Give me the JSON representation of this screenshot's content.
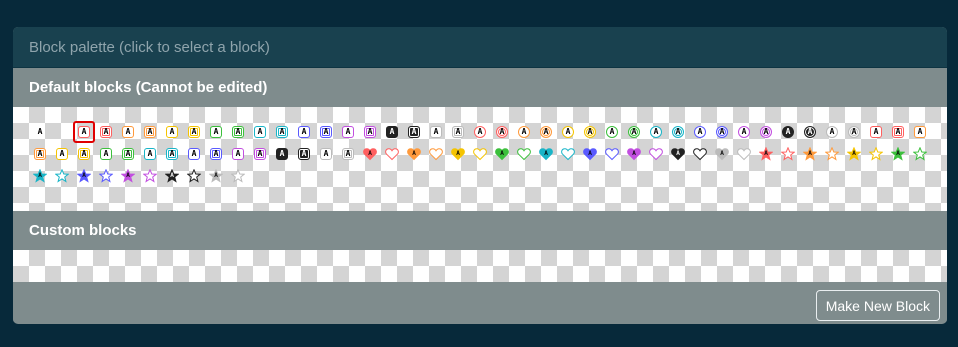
{
  "panel": {
    "header": "Block palette (click to select a block)",
    "default_title": "Default blocks (Cannot be edited)",
    "custom_title": "Custom blocks",
    "make_button": "Make New Block"
  },
  "glyph_letter": "A",
  "colors": {
    "red": "#ff6060",
    "orange": "#ff9a3c",
    "yellow": "#f5c400",
    "green": "#3cc03c",
    "teal": "#19b5c8",
    "blue": "#5a5aff",
    "purple": "#c24fe0",
    "black": "#222222",
    "white": "#bbbbbb"
  },
  "rows": [
    [
      {
        "shape": "plain",
        "color": "black",
        "icon": "plain-a-icon"
      },
      {
        "shape": "empty",
        "color": "none",
        "icon": "empty-block-icon"
      },
      {
        "shape": "square",
        "color": "red",
        "icon": "red-square-icon",
        "selected": true
      },
      {
        "shape": "square-inner",
        "color": "red",
        "icon": "red-square-inner-icon"
      },
      {
        "shape": "square",
        "color": "orange",
        "icon": "orange-square-icon"
      },
      {
        "shape": "square-inner",
        "color": "orange",
        "icon": "orange-square-inner-icon"
      },
      {
        "shape": "square",
        "color": "yellow",
        "icon": "yellow-square-icon"
      },
      {
        "shape": "square-inner",
        "color": "yellow",
        "icon": "yellow-square-inner-icon"
      },
      {
        "shape": "square",
        "color": "green",
        "icon": "green-square-icon"
      },
      {
        "shape": "square-inner",
        "color": "green",
        "icon": "green-square-inner-icon"
      },
      {
        "shape": "square",
        "color": "teal",
        "icon": "teal-square-icon"
      },
      {
        "shape": "square-inner",
        "color": "teal",
        "icon": "teal-square-inner-icon"
      },
      {
        "shape": "square",
        "color": "blue",
        "icon": "blue-square-icon"
      },
      {
        "shape": "square-inner",
        "color": "blue",
        "icon": "blue-square-inner-icon"
      },
      {
        "shape": "square",
        "color": "purple",
        "icon": "purple-square-icon"
      },
      {
        "shape": "square-inner",
        "color": "purple",
        "icon": "purple-square-inner-icon"
      },
      {
        "shape": "square",
        "color": "black",
        "icon": "black-square-icon",
        "fill": true
      },
      {
        "shape": "square-inner",
        "color": "black",
        "icon": "black-square-inner-icon",
        "fill": true
      },
      {
        "shape": "square",
        "color": "white",
        "icon": "white-square-icon"
      },
      {
        "shape": "square-inner",
        "color": "white",
        "icon": "white-square-inner-icon"
      },
      {
        "shape": "circle",
        "color": "red",
        "icon": "red-circle-icon"
      },
      {
        "shape": "circle-inner",
        "color": "red",
        "icon": "red-circle-inner-icon"
      },
      {
        "shape": "circle",
        "color": "orange",
        "icon": "orange-circle-icon"
      },
      {
        "shape": "circle-inner",
        "color": "orange",
        "icon": "orange-circle-inner-icon"
      },
      {
        "shape": "circle",
        "color": "yellow",
        "icon": "yellow-circle-icon"
      },
      {
        "shape": "circle-inner",
        "color": "yellow",
        "icon": "yellow-circle-inner-icon"
      },
      {
        "shape": "circle",
        "color": "green",
        "icon": "green-circle-icon"
      },
      {
        "shape": "circle-inner",
        "color": "green",
        "icon": "green-circle-inner-icon"
      },
      {
        "shape": "circle",
        "color": "teal",
        "icon": "teal-circle-icon"
      },
      {
        "shape": "circle-inner",
        "color": "teal",
        "icon": "teal-circle-inner-icon"
      },
      {
        "shape": "circle",
        "color": "blue",
        "icon": "blue-circle-icon"
      },
      {
        "shape": "circle-inner",
        "color": "blue",
        "icon": "blue-circle-inner-icon"
      },
      {
        "shape": "circle",
        "color": "purple",
        "icon": "purple-circle-icon"
      },
      {
        "shape": "circle-inner",
        "color": "purple",
        "icon": "purple-circle-inner-icon"
      },
      {
        "shape": "circle",
        "color": "black",
        "icon": "black-circle-icon",
        "fill": true
      },
      {
        "shape": "circle-inner",
        "color": "black",
        "icon": "black-circle-inner-icon",
        "fill": true
      },
      {
        "shape": "circle",
        "color": "white",
        "icon": "white-circle-icon"
      },
      {
        "shape": "circle-inner",
        "color": "white",
        "icon": "white-circle-inner-icon"
      },
      {
        "shape": "square",
        "color": "red",
        "icon": "red-square-alt-icon"
      },
      {
        "shape": "square-inner",
        "color": "red",
        "icon": "red-square-inner-alt-icon"
      },
      {
        "shape": "square",
        "color": "orange",
        "icon": "orange-square-alt-icon"
      }
    ],
    [
      {
        "shape": "square-inner",
        "color": "orange",
        "icon": "orange-square-inner-alt-icon"
      },
      {
        "shape": "square",
        "color": "yellow",
        "icon": "yellow-square-alt-icon"
      },
      {
        "shape": "square-inner",
        "color": "yellow",
        "icon": "yellow-square-inner-alt-icon"
      },
      {
        "shape": "square",
        "color": "green",
        "icon": "green-square-alt-icon"
      },
      {
        "shape": "square-inner",
        "color": "green",
        "icon": "green-square-inner-alt-icon"
      },
      {
        "shape": "square",
        "color": "teal",
        "icon": "teal-square-alt-icon"
      },
      {
        "shape": "square-inner",
        "color": "teal",
        "icon": "teal-square-inner-alt-icon"
      },
      {
        "shape": "square",
        "color": "blue",
        "icon": "blue-square-alt-icon"
      },
      {
        "shape": "square-inner",
        "color": "blue",
        "icon": "blue-square-inner-alt-icon"
      },
      {
        "shape": "square",
        "color": "purple",
        "icon": "purple-square-alt-icon"
      },
      {
        "shape": "square-inner",
        "color": "purple",
        "icon": "purple-square-inner-alt-icon"
      },
      {
        "shape": "square",
        "color": "black",
        "icon": "black-square-alt-icon",
        "fill": true
      },
      {
        "shape": "square-inner",
        "color": "black",
        "icon": "black-square-inner-alt-icon",
        "fill": true
      },
      {
        "shape": "square",
        "color": "white",
        "icon": "white-square-alt-icon"
      },
      {
        "shape": "square-inner",
        "color": "white",
        "icon": "white-square-inner-alt-icon"
      },
      {
        "shape": "heart",
        "color": "red",
        "icon": "red-heart-filled-icon",
        "fill": true
      },
      {
        "shape": "heart",
        "color": "red",
        "icon": "red-heart-icon"
      },
      {
        "shape": "heart",
        "color": "orange",
        "icon": "orange-heart-filled-icon",
        "fill": true
      },
      {
        "shape": "heart",
        "color": "orange",
        "icon": "orange-heart-icon"
      },
      {
        "shape": "heart",
        "color": "yellow",
        "icon": "yellow-heart-filled-icon",
        "fill": true
      },
      {
        "shape": "heart",
        "color": "yellow",
        "icon": "yellow-heart-icon"
      },
      {
        "shape": "heart",
        "color": "green",
        "icon": "green-heart-filled-icon",
        "fill": true
      },
      {
        "shape": "heart",
        "color": "green",
        "icon": "green-heart-icon"
      },
      {
        "shape": "heart",
        "color": "teal",
        "icon": "teal-heart-filled-icon",
        "fill": true
      },
      {
        "shape": "heart",
        "color": "teal",
        "icon": "teal-heart-icon"
      },
      {
        "shape": "heart",
        "color": "blue",
        "icon": "blue-heart-filled-icon",
        "fill": true
      },
      {
        "shape": "heart",
        "color": "blue",
        "icon": "blue-heart-icon"
      },
      {
        "shape": "heart",
        "color": "purple",
        "icon": "purple-heart-filled-icon",
        "fill": true
      },
      {
        "shape": "heart",
        "color": "purple",
        "icon": "purple-heart-icon"
      },
      {
        "shape": "heart",
        "color": "black",
        "icon": "black-heart-filled-icon",
        "fill": true
      },
      {
        "shape": "heart",
        "color": "black",
        "icon": "black-heart-icon"
      },
      {
        "shape": "heart",
        "color": "white",
        "icon": "white-heart-filled-icon",
        "fill": true
      },
      {
        "shape": "heart",
        "color": "white",
        "icon": "white-heart-icon"
      },
      {
        "shape": "star",
        "color": "red",
        "icon": "red-star-filled-icon",
        "fill": true
      },
      {
        "shape": "star",
        "color": "red",
        "icon": "red-star-icon"
      },
      {
        "shape": "star",
        "color": "orange",
        "icon": "orange-star-filled-icon",
        "fill": true
      },
      {
        "shape": "star",
        "color": "orange",
        "icon": "orange-star-icon"
      },
      {
        "shape": "star",
        "color": "yellow",
        "icon": "yellow-star-filled-icon",
        "fill": true
      },
      {
        "shape": "star",
        "color": "yellow",
        "icon": "yellow-star-icon"
      },
      {
        "shape": "star",
        "color": "green",
        "icon": "green-star-filled-icon",
        "fill": true
      },
      {
        "shape": "star",
        "color": "green",
        "icon": "green-star-icon"
      }
    ],
    [
      {
        "shape": "star",
        "color": "teal",
        "icon": "teal-star-filled-icon",
        "fill": true
      },
      {
        "shape": "star",
        "color": "teal",
        "icon": "teal-star-icon"
      },
      {
        "shape": "star",
        "color": "blue",
        "icon": "blue-star-filled-icon",
        "fill": true
      },
      {
        "shape": "star",
        "color": "blue",
        "icon": "blue-star-icon"
      },
      {
        "shape": "star",
        "color": "purple",
        "icon": "purple-star-filled-icon",
        "fill": true
      },
      {
        "shape": "star",
        "color": "purple",
        "icon": "purple-star-icon"
      },
      {
        "shape": "star",
        "color": "black",
        "icon": "black-star-filled-icon",
        "fill": true
      },
      {
        "shape": "star",
        "color": "black",
        "icon": "black-star-icon"
      },
      {
        "shape": "star",
        "color": "white",
        "icon": "white-star-filled-icon",
        "fill": true
      },
      {
        "shape": "star",
        "color": "white",
        "icon": "white-star-icon"
      }
    ]
  ]
}
